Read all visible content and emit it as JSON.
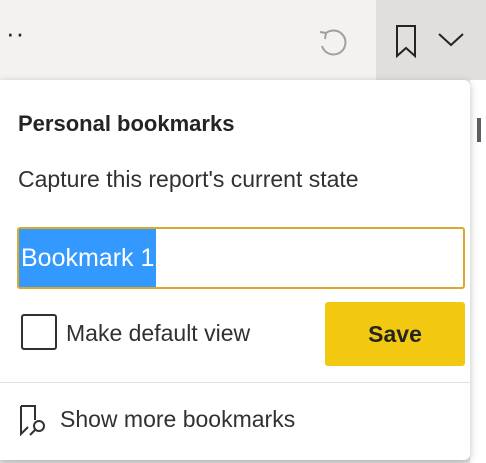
{
  "toolbar": {
    "ellipsis": "··",
    "reset_icon": "reset-icon",
    "bookmark_icon": "bookmark-icon",
    "dropdown_icon": "chevron-down-icon"
  },
  "popup": {
    "title": "Personal bookmarks",
    "subtitle": "Capture this report's current state",
    "name_input": {
      "value": "Bookmark 1",
      "selected": true
    },
    "default_view": {
      "label": "Make default view",
      "checked": false
    },
    "save_label": "Save",
    "show_more_label": "Show more bookmarks",
    "show_more_icon": "bookmark-search-icon"
  },
  "colors": {
    "save_button": "#f2c811",
    "input_border": "#d8a92b",
    "selection": "#3399ff"
  }
}
